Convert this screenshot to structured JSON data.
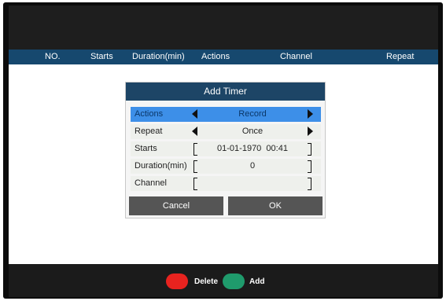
{
  "table": {
    "columns": [
      "NO.",
      "Starts",
      "Duration(min)",
      "Actions",
      "Channel",
      "Repeat"
    ]
  },
  "dialog": {
    "title": "Add Timer",
    "rows": [
      {
        "label": "Actions",
        "value": "Record",
        "type": "selector"
      },
      {
        "label": "Repeat",
        "value": "Once",
        "type": "selector"
      },
      {
        "label": "Starts",
        "value": "01-01-1970  00:41",
        "type": "field"
      },
      {
        "label": "Duration(min)",
        "value": "0",
        "type": "field"
      },
      {
        "label": "Channel",
        "value": "",
        "type": "field"
      }
    ],
    "cancel_label": "Cancel",
    "ok_label": "OK"
  },
  "hints": {
    "delete_label": "Delete",
    "add_label": "Add"
  },
  "colors": {
    "header_bg": "#16486e",
    "dialog_title_bg": "#1d4566",
    "selected_row_bg": "#3d8fe8",
    "delete_color": "#e8231f",
    "add_color": "#1f9b6c"
  }
}
